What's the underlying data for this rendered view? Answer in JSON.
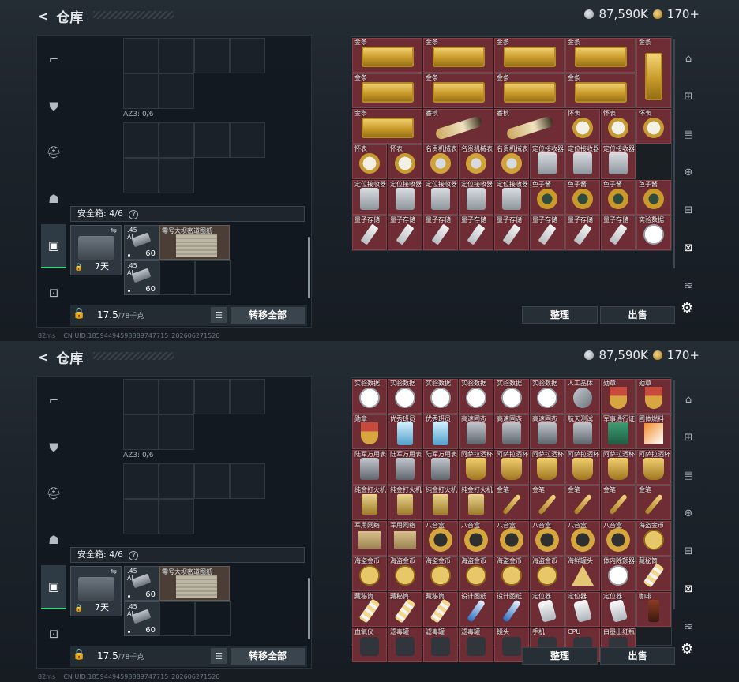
{
  "header": {
    "back_label": "<",
    "title": "仓库",
    "silver_amount": "87,590K",
    "gold_amount": "170+"
  },
  "left_categories": [
    {
      "name": "gun-icon",
      "glyph": "⌐"
    },
    {
      "name": "armor-icon",
      "glyph": "⛊"
    },
    {
      "name": "helmet-icon",
      "glyph": "⛑"
    },
    {
      "name": "backpack-icon",
      "glyph": "☗"
    },
    {
      "name": "case-icon",
      "glyph": "▣"
    },
    {
      "name": "toolbox-icon",
      "glyph": "⊡"
    }
  ],
  "left_panel": {
    "az3_label": "AZ3: 0/6",
    "safe_box_label": "安全箱: 4/6",
    "help_glyph": "?",
    "case_days": "7天",
    "ammo": [
      {
        "caliber": ".45\nAI",
        "count": "60"
      },
      {
        "caliber": ".45\nAI",
        "count": "60"
      }
    ],
    "map_label": "零号大坝密道图纸",
    "weight_value": "17.5",
    "weight_max": "/78千克",
    "list_glyph": "☰",
    "transfer_label": "转移全部"
  },
  "footer": {
    "status": "82ms",
    "uid": "CN UID:18594494598889747715_202606271526"
  },
  "inventory_top": {
    "row1": [
      "金条",
      "金条",
      "金条",
      "金条",
      "金条"
    ],
    "row2": [
      "金条",
      "金条",
      "金条",
      "金条"
    ],
    "row3": [
      "金条",
      "香槟",
      "香槟",
      "怀表",
      "怀表",
      "怀表"
    ],
    "row4": [
      "怀表",
      "怀表",
      "名贵机械表",
      "名贵机械表",
      "名贵机械表",
      "定位接收器",
      "定位接收器",
      "定位接收器"
    ],
    "row5": [
      "定位接收器",
      "定位接收器",
      "定位接收器",
      "定位接收器",
      "定位接收器",
      "鱼子酱",
      "鱼子酱",
      "鱼子酱",
      "鱼子酱"
    ],
    "row6": [
      "量子存储",
      "量子存储",
      "量子存储",
      "量子存储",
      "量子存储",
      "量子存储",
      "量子存储",
      "量子存储",
      "实验数据"
    ]
  },
  "inventory_bottom": {
    "row1": [
      "实验数据",
      "实验数据",
      "实验数据",
      "实验数据",
      "实验数据",
      "实验数据",
      "人工晶体",
      "勋章",
      "勋章"
    ],
    "row2": [
      "勋章",
      "优秀班员",
      "优秀班员",
      "高速固态",
      "高速固态",
      "高速固态",
      "航天测试",
      "军事通行证",
      "固体燃料"
    ],
    "row3": [
      "陆军万用表",
      "陆军万用表",
      "陆军万用表",
      "阿萨拉酒杯",
      "阿萨拉酒杯",
      "阿萨拉酒杯",
      "阿萨拉酒杯",
      "阿萨拉酒杯",
      "阿萨拉酒杯"
    ],
    "row4": [
      "纯金打火机",
      "纯金打火机",
      "纯金打火机",
      "纯金打火机",
      "金笔",
      "金笔",
      "金笔",
      "金笔",
      "金笔"
    ],
    "row5": [
      "军用网络",
      "军用网络",
      "八音盒",
      "八音盒",
      "八音盒",
      "八音盒",
      "八音盒",
      "八音盒",
      "海盗金币"
    ],
    "row6": [
      "海盗金币",
      "海盗金币",
      "海盗金币",
      "海盗金币",
      "海盗金币",
      "海盗金币",
      "海鲜罐头",
      "体内除颤器",
      "藏秘筒"
    ],
    "row7": [
      "藏秘筒",
      "藏秘筒",
      "藏秘筒",
      "设计图纸",
      "设计图纸",
      "定位器",
      "定位器",
      "定位器",
      "咖啡"
    ],
    "row8": [
      "血氧仪",
      "滤毒罐",
      "滤毒罐",
      "滤毒罐",
      "镜头",
      "手机",
      "CPU",
      "白墨出红瓶",
      ""
    ]
  },
  "right_col": {
    "icons": [
      "store-icon",
      "scan-icon",
      "document-icon",
      "add-icon",
      "search-panel-icon",
      "arrange-icon",
      "filter-icon"
    ]
  },
  "buttons": {
    "organize": "整理",
    "sell": "出售"
  },
  "colors": {
    "accent_green": "#39d07a",
    "valuable_red": "#6e2c34",
    "gold": "#c99a2a"
  }
}
